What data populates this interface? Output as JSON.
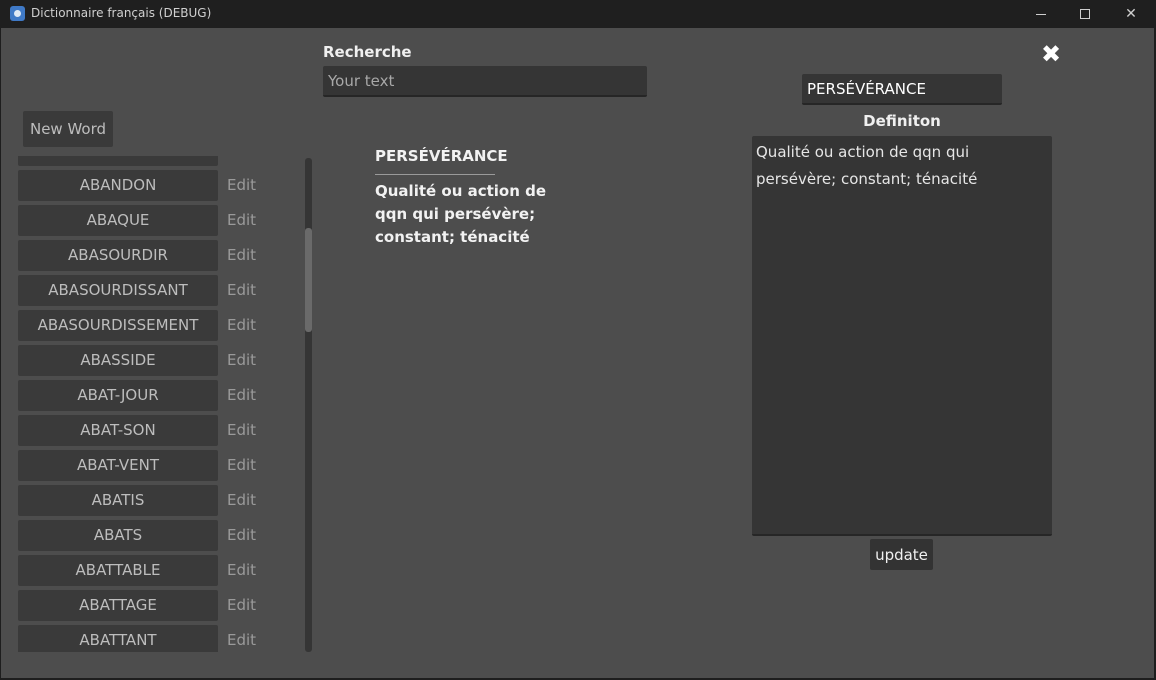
{
  "window": {
    "title": "Dictionnaire français (DEBUG)",
    "minimize_glyph": "",
    "maximize_glyph": "",
    "close_glyph": "✕"
  },
  "search": {
    "label": "Recherche",
    "placeholder": "Your text",
    "value": ""
  },
  "close_glyph": "✖",
  "new_word_label": "New Word",
  "word_list": {
    "edit_label": "Edit",
    "items": [
      "ABANDON",
      "ABAQUE",
      "ABASOURDIR",
      "ABASOURDISSANT",
      "ABASOURDISSEMENT",
      "ABASSIDE",
      "ABAT-JOUR",
      "ABAT-SON",
      "ABAT-VENT",
      "ABATIS",
      "ABATS",
      "ABATTABLE",
      "ABATTAGE",
      "ABATTANT"
    ]
  },
  "preview": {
    "word": "PERSÉVÉRANCE",
    "definition": "Qualité ou action de qqn qui persévère; constant; ténacité"
  },
  "editor": {
    "word_value": "PERSÉVÉRANCE",
    "definition_label": "Definiton",
    "definition_value": "Qualité ou action de qqn qui persévère; constant; ténacité",
    "update_label": "update"
  },
  "colors": {
    "background": "#4d4d4d",
    "panel": "#3a3a3a",
    "titlebar": "#1f1f1f",
    "text": "#f0f0f0",
    "muted_text": "#bdbdbd"
  }
}
